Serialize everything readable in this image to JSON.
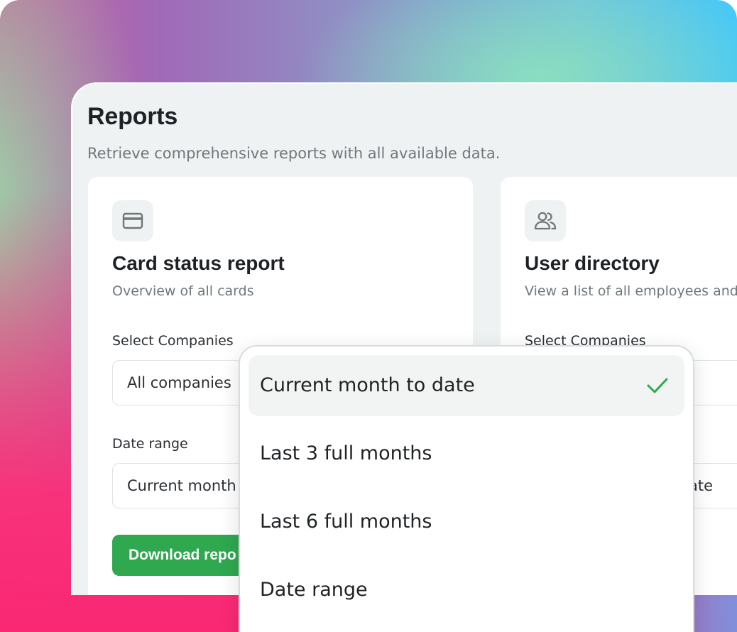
{
  "page": {
    "title": "Reports",
    "subtitle": "Retrieve comprehensive reports with all available data."
  },
  "cards": [
    {
      "icon": "credit-card-icon",
      "title": "Card status report",
      "description": "Overview of all cards",
      "companies_label": "Select Companies",
      "companies_value": "All companies",
      "date_label": "Date range",
      "date_value": "Current month",
      "download_label": "Download repo"
    },
    {
      "icon": "users-icon",
      "title": "User directory",
      "description": "View a list of all employees and",
      "companies_label": "Select Companies",
      "date_value": "ate"
    }
  ],
  "dropdown": {
    "options": [
      {
        "label": "Current month to date",
        "selected": true
      },
      {
        "label": "Last 3 full months",
        "selected": false
      },
      {
        "label": "Last 6 full months",
        "selected": false
      },
      {
        "label": "Date range",
        "selected": false
      }
    ]
  },
  "colors": {
    "accent_green": "#2fa84f",
    "check_green": "#2fa84f",
    "panel_bg": "#eff2f3",
    "text_primary": "#1f2225",
    "text_muted": "#70787c"
  }
}
